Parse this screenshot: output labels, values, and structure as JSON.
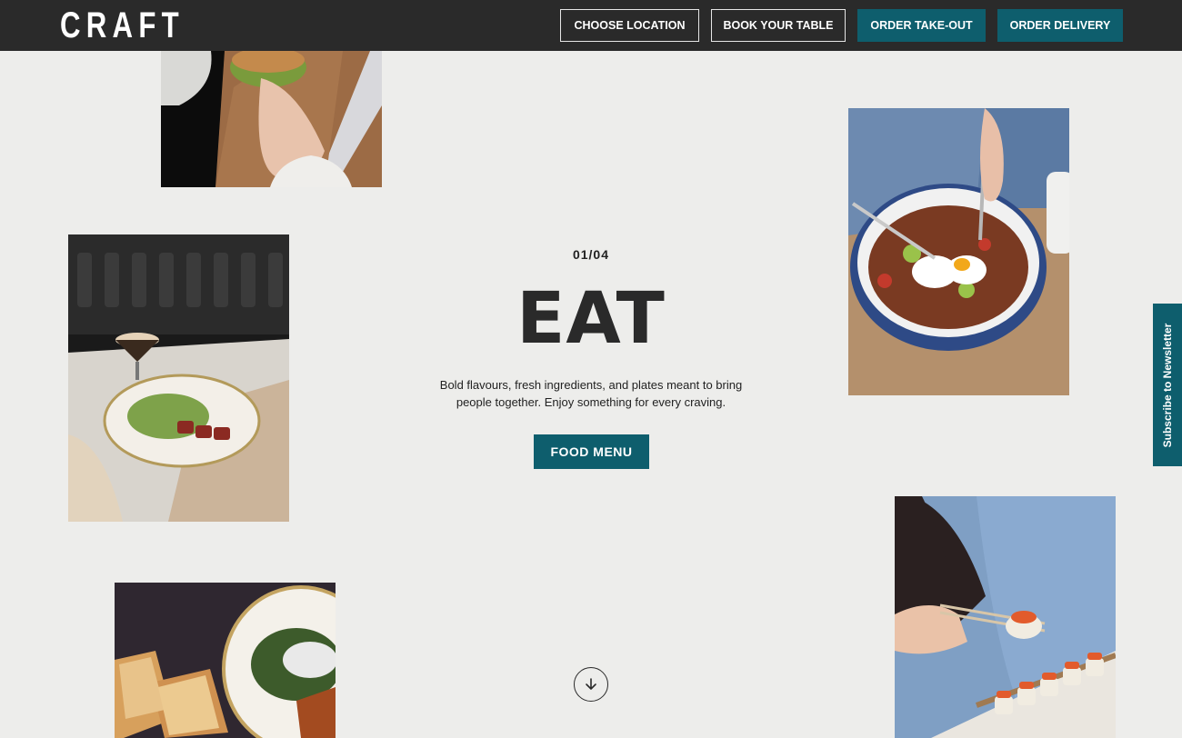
{
  "header": {
    "logo": "CRAFT",
    "nav": [
      {
        "label": "CHOOSE LOCATION",
        "style": "outline"
      },
      {
        "label": "BOOK YOUR TABLE",
        "style": "outline"
      },
      {
        "label": "ORDER TAKE-OUT",
        "style": "filled"
      },
      {
        "label": "ORDER DELIVERY",
        "style": "filled"
      }
    ]
  },
  "hero": {
    "counter": "01/04",
    "headline": "EAT",
    "description": "Bold flavours, fresh ingredients, and plates meant to bring people together. Enjoy something for every craving.",
    "cta": "FOOD MENU"
  },
  "newsletter": {
    "label": "Subscribe to Newsletter"
  },
  "icons": {
    "scroll": "arrow-down-icon"
  },
  "colors": {
    "accent": "#0e5e6d",
    "header_bg": "#2a2a2a",
    "page_bg": "#ededeb"
  }
}
